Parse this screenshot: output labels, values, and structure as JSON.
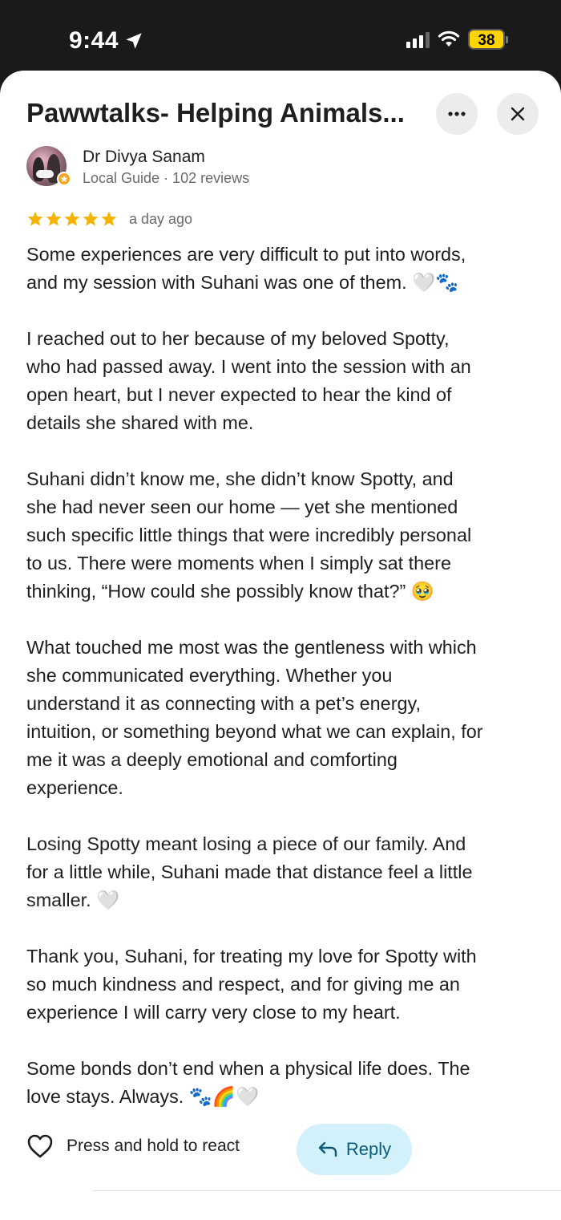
{
  "status_bar": {
    "time": "9:44",
    "battery": "38"
  },
  "sheet": {
    "title": "Pawwtalks- Helping Animals..."
  },
  "review": {
    "author": "Dr Divya Sanam",
    "author_meta": "Local Guide · 102 reviews",
    "rating": 5,
    "date": "a day ago",
    "paragraphs": [
      "Some experiences are very difficult to put into words,\nand my session with Suhani was one of them. 🤍🐾",
      "I reached out to her because of my beloved Spotty,\nwho had passed away. I went into the session with an\nopen heart, but I never expected to hear the kind of\ndetails she shared with me.",
      "Suhani didn’t know me, she didn’t know Spotty, and\nshe had never seen our home — yet she mentioned\nsuch specific little things that were incredibly personal\nto us. There were moments when I simply sat there\nthinking, “How could she possibly know that?” 🥹",
      "What touched me most was the gentleness with which\nshe communicated everything. Whether you\nunderstand it as connecting with a pet’s energy,\nintuition, or something beyond what we can explain, for\nme it was a deeply emotional and comforting\nexperience.",
      "Losing Spotty meant losing a piece of our family. And\nfor a little while, Suhani made that distance feel a little\nsmaller. 🤍",
      "Thank you, Suhani, for treating my love for Spotty with\nso much kindness and respect, and for giving me an\nexperience I will carry very close to my heart.",
      "Some bonds don’t end when a physical life does. The\nlove stays. Always. 🐾🌈🤍"
    ]
  },
  "actions": {
    "react_label": "Press and hold to react",
    "reply_label": "Reply"
  },
  "colors": {
    "star": "#f5b400",
    "reply_bg": "#d3f1fb",
    "reply_text": "#0b5b7a",
    "battery": "#ffd400"
  },
  "icons": {
    "location": "location-arrow-icon",
    "more": "more-horizontal-icon",
    "close": "close-icon",
    "heart": "heart-outline-icon",
    "reply": "reply-arrow-icon"
  }
}
